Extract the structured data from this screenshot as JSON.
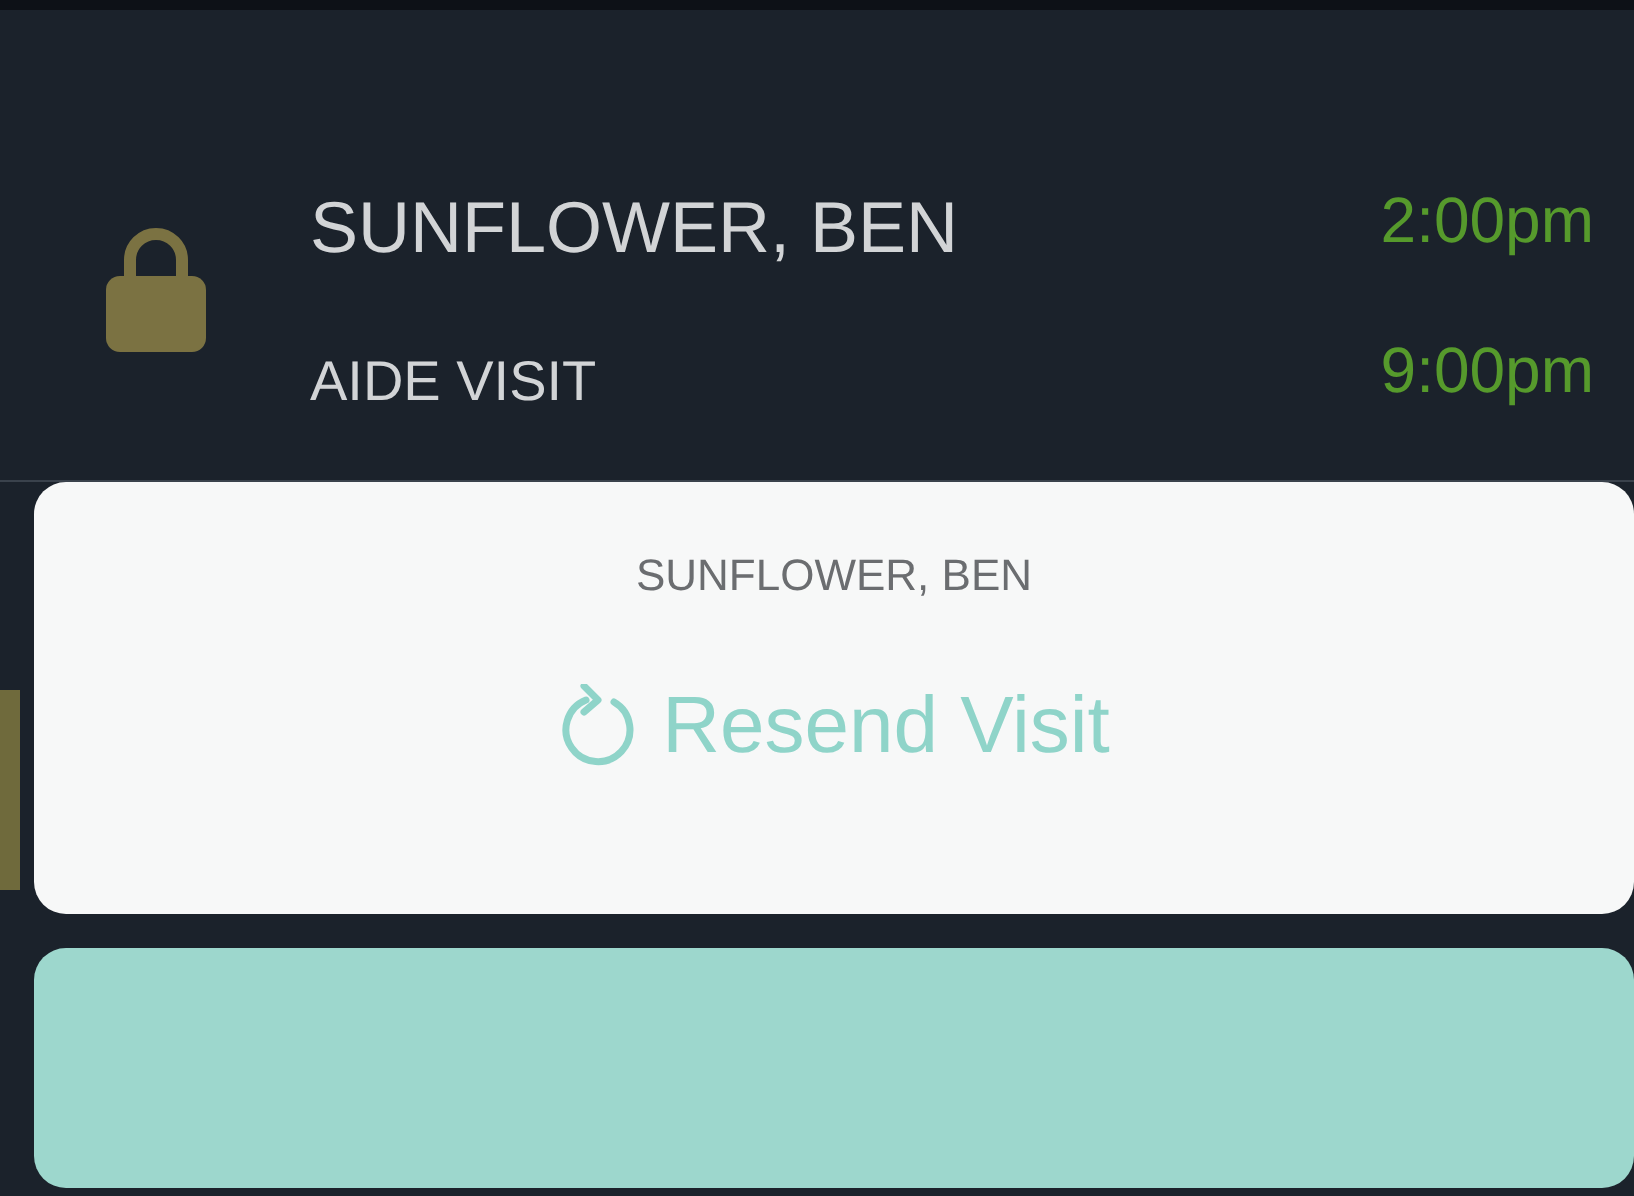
{
  "visit": {
    "client": "SUNFLOWER, BEN",
    "type": "AIDE VISIT",
    "start": "2:00pm",
    "end": "9:00pm",
    "locked": true
  },
  "action_sheet": {
    "title": "SUNFLOWER, BEN",
    "actions": [
      {
        "label": "Resend Visit",
        "kind": "resend"
      }
    ]
  },
  "cancel_button": {
    "kind": "blank"
  }
}
